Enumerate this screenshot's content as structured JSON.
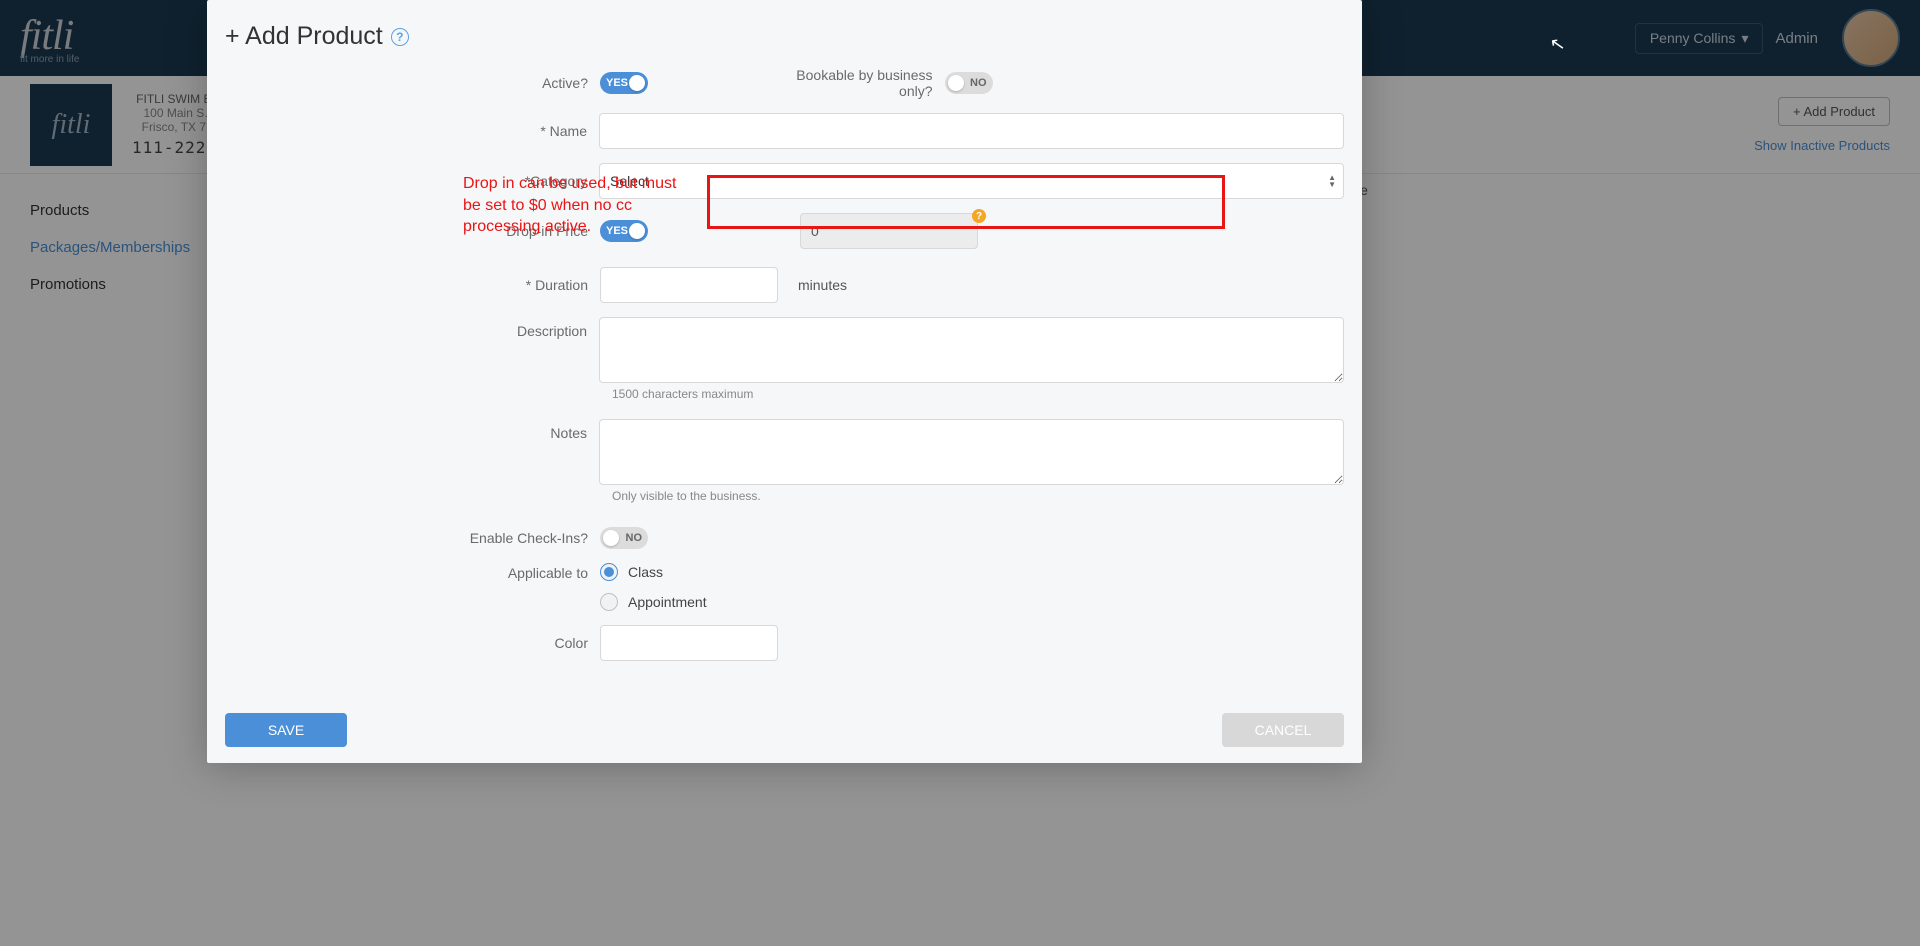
{
  "header": {
    "logo_text": "fitli",
    "logo_tag": "fit more in life",
    "user_name": "Penny Collins",
    "admin_label": "Admin"
  },
  "business": {
    "logo_text": "fitli",
    "name": "FITLI SWIM B…",
    "addr1": "100 Main S…",
    "addr2": "Frisco, TX 7…",
    "phone": "111-222-…"
  },
  "sub_header": {
    "add_product_btn": "+ Add Product",
    "show_inactive": "Show Inactive Products",
    "content_hint": "ive"
  },
  "nav": {
    "items": [
      {
        "label": "Products",
        "active": false
      },
      {
        "label": "Packages/Memberships",
        "active": true
      },
      {
        "label": "Promotions",
        "active": false
      }
    ]
  },
  "modal": {
    "title": "+ Add Product",
    "labels": {
      "active": "Active?",
      "bookable": "Bookable by business only?",
      "name": "* Name",
      "category": "*Category",
      "dropin": "Drop-in Price",
      "duration": "* Duration",
      "description": "Description",
      "notes": "Notes",
      "checkins": "Enable Check-Ins?",
      "applicable": "Applicable to",
      "color": "Color"
    },
    "toggles": {
      "active": {
        "state": "on",
        "text": "YES"
      },
      "bookable": {
        "state": "off",
        "text": "NO"
      },
      "dropin": {
        "state": "on",
        "text": "YES"
      },
      "checkins": {
        "state": "off",
        "text": "NO"
      }
    },
    "category_placeholder": "Select",
    "dropin_value": "0",
    "duration_unit": "minutes",
    "desc_hint": "1500 characters maximum",
    "notes_hint": "Only visible to the business.",
    "radio": {
      "class": "Class",
      "appointment": "Appointment"
    },
    "buttons": {
      "save": "SAVE",
      "cancel": "CANCEL"
    }
  },
  "annotation": "Drop in can be used, but must be set to $0 when no cc processing active."
}
